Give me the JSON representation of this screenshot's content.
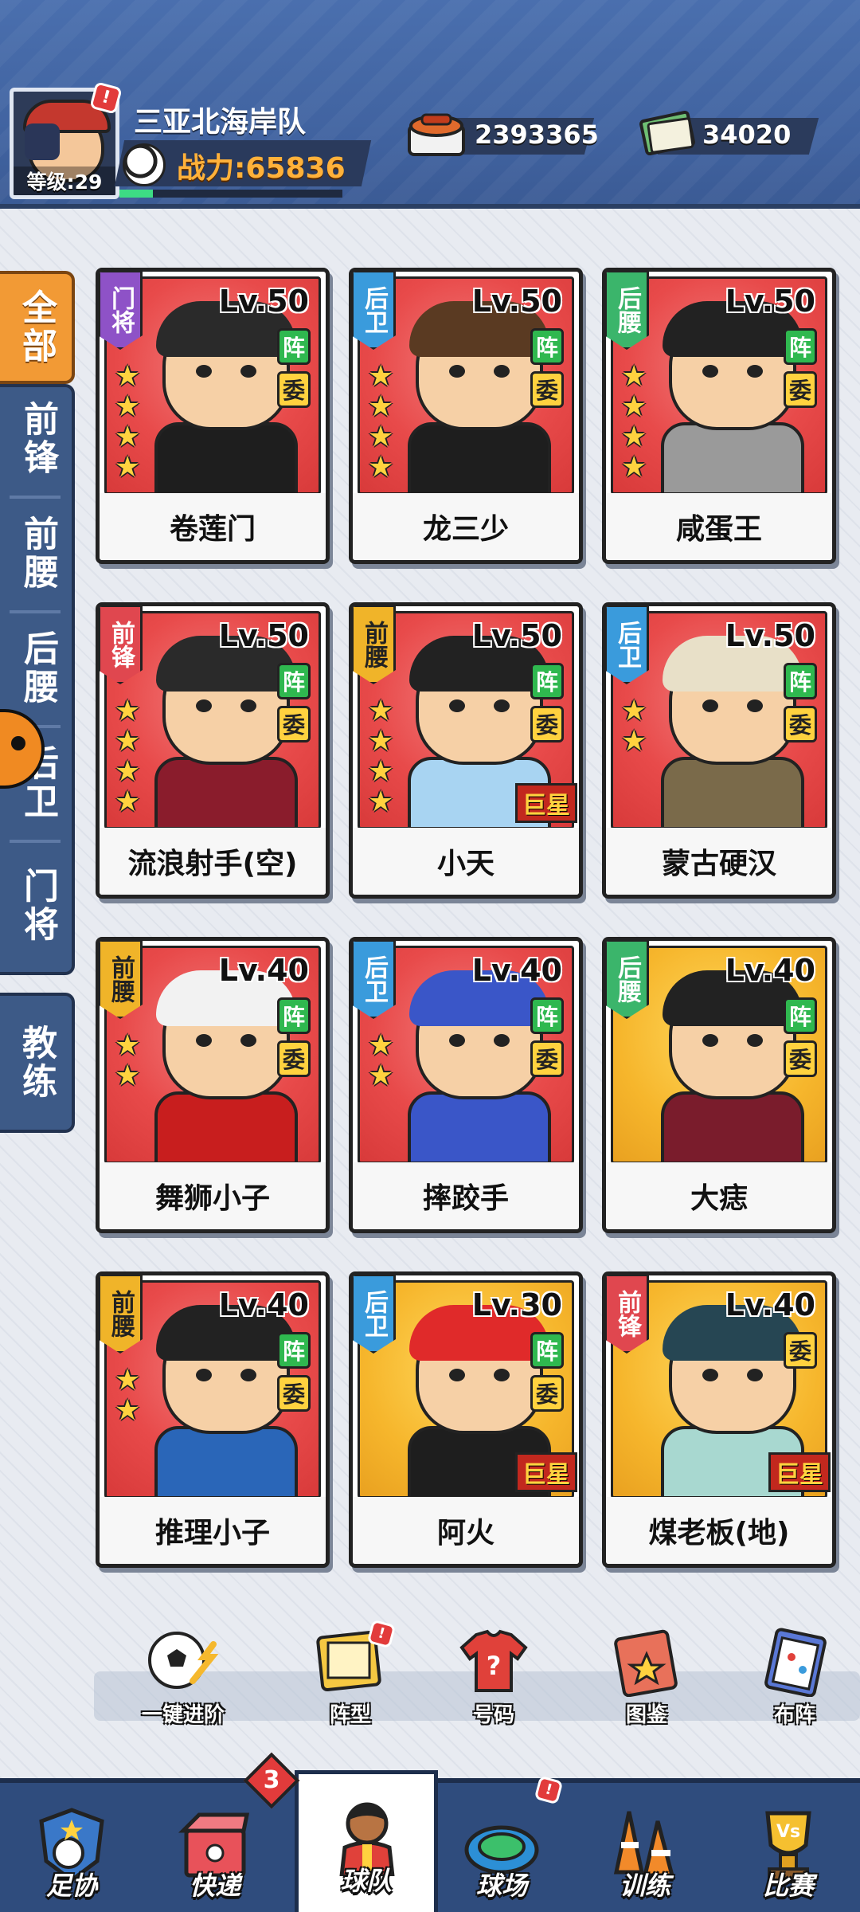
{
  "header": {
    "level_label": "等级:29",
    "team_name": "三亚北海岸队",
    "power_label": "战力:65836",
    "xp_progress": 0.15,
    "resource_1": "2393365",
    "resource_2": "34020"
  },
  "side_tabs": [
    {
      "label": "全部",
      "active": true
    },
    {
      "label": "前锋"
    },
    {
      "label": "前腰"
    },
    {
      "label": "后腰"
    },
    {
      "label": "后卫"
    },
    {
      "label": "门将"
    },
    {
      "label": "教练"
    }
  ],
  "cards": [
    {
      "name": "卷莲门",
      "level": "Lv.50",
      "position": "门将",
      "tags": [
        "阵",
        "委"
      ],
      "stars": 4,
      "bg": "red"
    },
    {
      "name": "龙三少",
      "level": "Lv.50",
      "position": "后卫",
      "tags": [
        "阵",
        "委"
      ],
      "stars": 4,
      "bg": "red"
    },
    {
      "name": "咸蛋王",
      "level": "Lv.50",
      "position": "后腰",
      "tags": [
        "阵",
        "委"
      ],
      "stars": 4,
      "bg": "red"
    },
    {
      "name": "流浪射手(空)",
      "level": "Lv.50",
      "position": "前锋",
      "tags": [
        "阵",
        "委"
      ],
      "stars": 4,
      "bg": "red"
    },
    {
      "name": "小天",
      "level": "Lv.50",
      "position": "前腰",
      "tags": [
        "阵",
        "委"
      ],
      "stars": 4,
      "bg": "red",
      "badge": "巨星"
    },
    {
      "name": "蒙古硬汉",
      "level": "Lv.50",
      "position": "后卫",
      "tags": [
        "阵",
        "委"
      ],
      "stars": 2,
      "bg": "red"
    },
    {
      "name": "舞狮小子",
      "level": "Lv.40",
      "position": "前腰",
      "tags": [
        "阵",
        "委"
      ],
      "stars": 2,
      "bg": "red"
    },
    {
      "name": "摔跤手",
      "level": "Lv.40",
      "position": "后卫",
      "tags": [
        "阵",
        "委"
      ],
      "stars": 2,
      "bg": "red"
    },
    {
      "name": "大痣",
      "level": "Lv.40",
      "position": "后腰",
      "tags": [
        "阵",
        "委"
      ],
      "stars": 0,
      "bg": "yellow"
    },
    {
      "name": "推理小子",
      "level": "Lv.40",
      "position": "前腰",
      "tags": [
        "阵",
        "委"
      ],
      "stars": 2,
      "bg": "red"
    },
    {
      "name": "阿火",
      "level": "Lv.30",
      "position": "后卫",
      "tags": [
        "阵",
        "委"
      ],
      "stars": 0,
      "bg": "yellow",
      "badge": "巨星"
    },
    {
      "name": "煤老板(地)",
      "level": "Lv.40",
      "position": "前锋",
      "tags": [
        "委"
      ],
      "stars": 0,
      "bg": "yellow",
      "badge": "巨星"
    }
  ],
  "features": [
    {
      "label": "一键进阶"
    },
    {
      "label": "阵型"
    },
    {
      "label": "号码"
    },
    {
      "label": "图鉴"
    },
    {
      "label": "布阵"
    }
  ],
  "bottom_nav": [
    {
      "label": "足协"
    },
    {
      "label": "快递",
      "count": "3"
    },
    {
      "label": "球队",
      "active": true
    },
    {
      "label": "球场"
    },
    {
      "label": "训练"
    },
    {
      "label": "比赛"
    }
  ],
  "colors": {
    "header_bg": "#4a6fae",
    "active_tab": "#f29a35",
    "tab_bg": "#3d5a87",
    "power_text": "#ffb13a",
    "card_red": "#e84a4a",
    "card_yellow": "#f6b62c",
    "tag_green": "#2fb84f",
    "tag_yellow": "#ffd23f"
  }
}
